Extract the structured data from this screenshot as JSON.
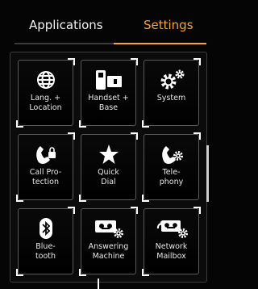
{
  "tabs": {
    "applications": "Applications",
    "settings": "Settings",
    "active_color": "#f6a623"
  },
  "tiles": [
    {
      "label": "Lang. +\nLocation",
      "icon": "globe-icon"
    },
    {
      "label": "Handset +\nBase",
      "icon": "handset-base-icon"
    },
    {
      "label": "System",
      "icon": "gears-icon"
    },
    {
      "label": "Call Pro-\ntection",
      "icon": "phone-lock-icon"
    },
    {
      "label": "Quick\nDial",
      "icon": "star-icon"
    },
    {
      "label": "Tele-\nphony",
      "icon": "phone-gear-icon"
    },
    {
      "label": "Blue-\ntooth",
      "icon": "bluetooth-icon"
    },
    {
      "label": "Answering\nMachine",
      "icon": "tape-gear-icon"
    },
    {
      "label": "Network\nMailbox",
      "icon": "network-tape-gear-icon"
    }
  ]
}
